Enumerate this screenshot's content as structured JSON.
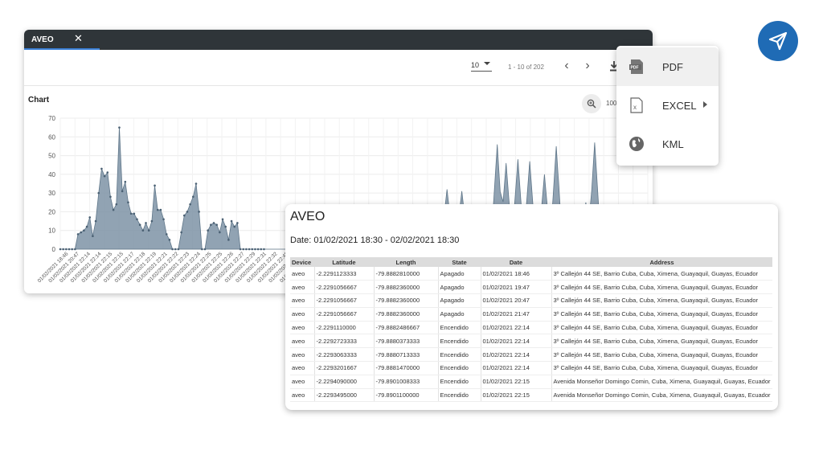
{
  "window": {
    "tab_label": "AVEO",
    "close_glyph": "✕",
    "accent": "#3a7fd5",
    "titlebar_color": "#2f3539"
  },
  "toolbar": {
    "page_size": "10",
    "page_range": "1 - 10 of 202",
    "prev_glyph": "‹",
    "next_glyph": "›",
    "download_icon": "download-icon"
  },
  "chart_panel": {
    "title": "Chart",
    "zoom_level": "100",
    "zoom_icon": "zoom-in-icon"
  },
  "chart_data": {
    "type": "area",
    "color": "#7e93a6",
    "ylim": [
      0,
      70
    ],
    "yticks": [
      0,
      10,
      20,
      30,
      40,
      50,
      60,
      70
    ],
    "grid": true,
    "xticks": [
      "01/02/2021 18:46",
      "01/02/2021 20:47",
      "01/02/2021 22:14",
      "01/02/2021 22:14",
      "01/02/2021 22:15",
      "01/02/2021 22:15",
      "01/02/2021 22:17",
      "01/02/2021 22:18",
      "01/02/2021 22:19",
      "01/02/2021 22:21",
      "01/02/2021 22:22",
      "01/02/2021 22:23",
      "01/02/2021 22:24",
      "01/02/2021 22:25",
      "01/02/2021 22:25",
      "01/02/2021 22:26",
      "01/02/2021 22:27",
      "01/02/2021 22:29",
      "01/02/2021 22:31",
      "01/02/2021 22:32",
      "01/02/2021 22:45",
      "01/02/2021 22:45",
      "01/02/2021 22:46",
      "01/02/2021 22:46"
    ],
    "values": [
      0,
      0,
      0,
      0,
      0,
      0,
      8,
      9,
      10,
      12,
      17,
      7,
      15,
      30,
      43,
      39,
      41,
      28,
      21,
      24,
      65,
      31,
      36,
      25,
      19,
      19,
      16,
      13,
      10,
      14,
      10,
      15,
      34,
      21,
      21,
      16,
      8,
      5,
      0,
      0,
      0,
      9,
      18,
      20,
      24,
      28,
      35,
      20,
      0,
      0,
      10,
      13,
      14,
      13,
      9,
      16,
      12,
      5,
      15,
      12,
      14,
      0,
      0,
      0,
      0,
      0,
      0,
      0,
      0,
      0,
      0,
      0,
      0,
      0,
      0,
      0,
      0,
      0,
      0,
      0,
      0,
      0,
      0,
      0,
      0,
      0,
      0,
      0,
      0,
      0,
      0,
      0,
      0,
      0,
      0,
      0,
      0,
      0,
      0,
      0,
      0,
      0,
      0,
      0,
      0,
      0,
      0,
      0,
      0,
      0,
      0,
      0,
      0,
      0,
      0,
      0,
      0,
      0,
      0,
      0,
      0,
      0,
      0,
      0,
      0,
      0,
      0,
      0,
      0,
      0,
      0,
      0,
      0,
      0,
      0,
      0,
      0,
      0,
      0,
      0,
      0,
      0,
      0,
      0,
      0,
      0,
      0,
      0,
      0,
      0,
      0,
      0,
      0,
      0,
      0,
      0,
      0,
      0,
      0,
      0,
      0,
      0,
      0,
      0,
      0,
      0,
      0,
      0,
      0,
      0,
      0,
      0,
      0,
      0,
      0,
      0,
      0,
      0,
      0,
      0,
      0,
      0,
      0,
      0,
      0,
      0,
      0,
      0,
      0,
      0,
      0,
      0,
      0,
      0,
      0,
      0,
      0,
      0,
      0,
      0,
      0,
      0,
      0,
      0,
      0,
      0,
      0,
      0,
      0,
      0,
      0,
      0,
      0,
      0
    ],
    "peaks_right": [
      {
        "x": 131,
        "y": 32
      },
      {
        "x": 136,
        "y": 31
      },
      {
        "x": 148,
        "y": 56
      },
      {
        "x": 151,
        "y": 46
      },
      {
        "x": 155,
        "y": 48
      },
      {
        "x": 159,
        "y": 47
      },
      {
        "x": 164,
        "y": 40
      },
      {
        "x": 168,
        "y": 55
      },
      {
        "x": 176,
        "y": 24
      },
      {
        "x": 178,
        "y": 25
      },
      {
        "x": 181,
        "y": 57
      }
    ]
  },
  "export_menu": {
    "items": [
      {
        "label": "PDF",
        "icon": "pdf-file-icon"
      },
      {
        "label": "EXCEL",
        "icon": "excel-file-icon"
      },
      {
        "label": "KML",
        "icon": "globe-icon"
      }
    ]
  },
  "send_button": {
    "icon": "navigation-arrow-icon",
    "color": "#1f6bb5"
  },
  "report": {
    "title": "AVEO",
    "date": "Date: 01/02/2021 18:30 - 02/02/2021 18:30",
    "columns": [
      "Device",
      "Latitude",
      "Length",
      "State",
      "Date",
      "Address"
    ],
    "rows": [
      [
        "aveo",
        "-2.2291123333",
        "-79.8882810000",
        "Apagado",
        "01/02/2021 18:46",
        "3º Callejón 44 SE, Barrio Cuba, Cuba, Ximena, Guayaquil, Guayas, Ecuador"
      ],
      [
        "aveo",
        "-2.2291056667",
        "-79.8882360000",
        "Apagado",
        "01/02/2021 19:47",
        "3º Callejón 44 SE, Barrio Cuba, Cuba, Ximena, Guayaquil, Guayas, Ecuador"
      ],
      [
        "aveo",
        "-2.2291056667",
        "-79.8882360000",
        "Apagado",
        "01/02/2021 20:47",
        "3º Callejón 44 SE, Barrio Cuba, Cuba, Ximena, Guayaquil, Guayas, Ecuador"
      ],
      [
        "aveo",
        "-2.2291056667",
        "-79.8882360000",
        "Apagado",
        "01/02/2021 21:47",
        "3º Callejón 44 SE, Barrio Cuba, Cuba, Ximena, Guayaquil, Guayas, Ecuador"
      ],
      [
        "aveo",
        "-2.2291110000",
        "-79.8882486667",
        "Encendido",
        "01/02/2021 22:14",
        "3º Callejón 44 SE, Barrio Cuba, Cuba, Ximena, Guayaquil, Guayas, Ecuador"
      ],
      [
        "aveo",
        "-2.2292723333",
        "-79.8880373333",
        "Encendido",
        "01/02/2021 22:14",
        "3º Callejón 44 SE, Barrio Cuba, Cuba, Ximena, Guayaquil, Guayas, Ecuador"
      ],
      [
        "aveo",
        "-2.2293063333",
        "-79.8880713333",
        "Encendido",
        "01/02/2021 22:14",
        "3º Callejón 44 SE, Barrio Cuba, Cuba, Ximena, Guayaquil, Guayas, Ecuador"
      ],
      [
        "aveo",
        "-2.2293201667",
        "-79.8881470000",
        "Encendido",
        "01/02/2021 22:14",
        "3º Callejón 44 SE, Barrio Cuba, Cuba, Ximena, Guayaquil, Guayas, Ecuador"
      ],
      [
        "aveo",
        "-2.2294090000",
        "-79.8901008333",
        "Encendido",
        "01/02/2021 22:15",
        "Avenida Monseñor Domingo Comin, Cuba, Ximena, Guayaquil, Guayas, Ecuador"
      ],
      [
        "aveo",
        "-2.2293495000",
        "-79.8901100000",
        "Encendido",
        "01/02/2021 22:15",
        "Avenida Monseñor Domingo Comin, Cuba, Ximena, Guayaquil, Guayas, Ecuador"
      ]
    ]
  }
}
